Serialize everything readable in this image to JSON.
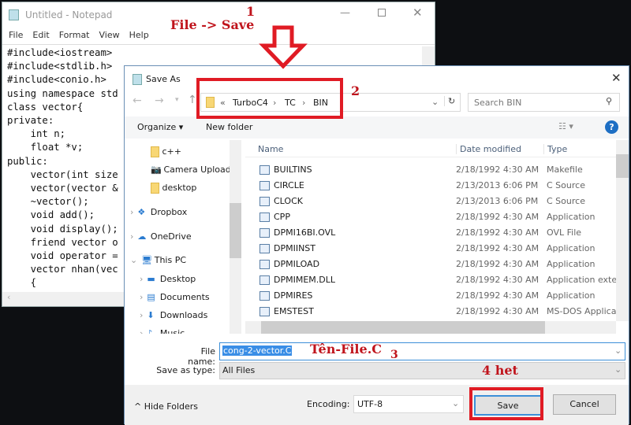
{
  "notepad": {
    "title": "Untitled - Notepad",
    "menu": [
      "File",
      "Edit",
      "Format",
      "View",
      "Help"
    ],
    "code": "#include<iostream>\n#include<stdlib.h>\n#include<conio.h>\nusing namespace std\nclass vector{\nprivate:\n    int n;\n    float *v;\npublic:\n    vector(int size\n    vector(vector &\n    ~vector();\n    void add();\n    void display();\n    friend vector o\n    void operator =\n    vector nhan(vec\n    {"
  },
  "dialog": {
    "title": "Save As",
    "breadcrumb": [
      "«",
      "TurboC4",
      "TC",
      "BIN"
    ],
    "search_placeholder": "Search BIN",
    "organize": "Organize ▾",
    "new_folder": "New folder",
    "nav": [
      {
        "label": "c++",
        "icon": "folder-icon"
      },
      {
        "label": "Camera Uploads",
        "icon": "camera-icon"
      },
      {
        "label": "desktop",
        "icon": "folder-icon"
      },
      {
        "label": "Dropbox",
        "icon": "dropbox-icon"
      },
      {
        "label": "OneDrive",
        "icon": "cloud-icon"
      },
      {
        "label": "This PC",
        "icon": "computer-icon"
      },
      {
        "label": "Desktop",
        "icon": "desktop-icon"
      },
      {
        "label": "Documents",
        "icon": "documents-icon"
      },
      {
        "label": "Downloads",
        "icon": "download-icon"
      },
      {
        "label": "Music",
        "icon": "music-icon"
      }
    ],
    "columns": [
      "Name",
      "Date modified",
      "Type"
    ],
    "files": [
      {
        "name": "BUILTINS",
        "date": "2/18/1992 4:30 AM",
        "type": "Makefile"
      },
      {
        "name": "CIRCLE",
        "date": "2/13/2013 6:06 PM",
        "type": "C Source"
      },
      {
        "name": "CLOCK",
        "date": "2/13/2013 6:06 PM",
        "type": "C Source"
      },
      {
        "name": "CPP",
        "date": "2/18/1992 4:30 AM",
        "type": "Application"
      },
      {
        "name": "DPMI16BI.OVL",
        "date": "2/18/1992 4:30 AM",
        "type": "OVL File"
      },
      {
        "name": "DPMIINST",
        "date": "2/18/1992 4:30 AM",
        "type": "Application"
      },
      {
        "name": "DPMILOAD",
        "date": "2/18/1992 4:30 AM",
        "type": "Application"
      },
      {
        "name": "DPMIMEM.DLL",
        "date": "2/18/1992 4:30 AM",
        "type": "Application exten"
      },
      {
        "name": "DPMIRES",
        "date": "2/18/1992 4:30 AM",
        "type": "Application"
      },
      {
        "name": "EMSTEST",
        "date": "2/18/1992 4:30 AM",
        "type": "MS-DOS Applicat"
      }
    ],
    "file_name_label": "File name:",
    "file_name": "cong-2-vector.C",
    "save_type_label": "Save as type:",
    "save_type": "All Files",
    "hide_folders": "Hide Folders",
    "encoding_label": "Encoding:",
    "encoding": "UTF-8",
    "save": "Save",
    "cancel": "Cancel"
  },
  "annotations": {
    "step1_num": "1",
    "step1": "File -> Save",
    "step2": "2",
    "step3_text": "Tên-File.C",
    "step3": "3",
    "step4": "4 het",
    "color": "#e01b24"
  }
}
